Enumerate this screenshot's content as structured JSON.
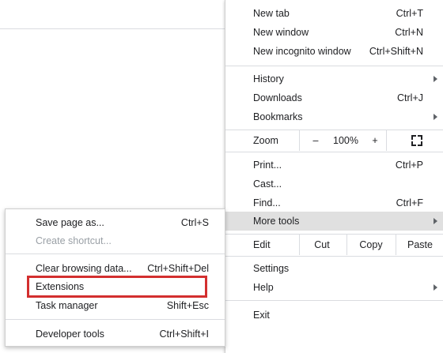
{
  "main_menu": {
    "new_tab": {
      "label": "New tab",
      "shortcut": "Ctrl+T"
    },
    "new_window": {
      "label": "New window",
      "shortcut": "Ctrl+N"
    },
    "new_incognito": {
      "label": "New incognito window",
      "shortcut": "Ctrl+Shift+N"
    },
    "history": {
      "label": "History"
    },
    "downloads": {
      "label": "Downloads",
      "shortcut": "Ctrl+J"
    },
    "bookmarks": {
      "label": "Bookmarks"
    },
    "zoom": {
      "label": "Zoom",
      "minus": "–",
      "value": "100%",
      "plus": "+"
    },
    "print": {
      "label": "Print...",
      "shortcut": "Ctrl+P"
    },
    "cast": {
      "label": "Cast..."
    },
    "find": {
      "label": "Find...",
      "shortcut": "Ctrl+F"
    },
    "more_tools": {
      "label": "More tools"
    },
    "edit": {
      "label": "Edit",
      "cut": "Cut",
      "copy": "Copy",
      "paste": "Paste"
    },
    "settings": {
      "label": "Settings"
    },
    "help": {
      "label": "Help"
    },
    "exit": {
      "label": "Exit"
    }
  },
  "more_tools_submenu": {
    "save_page": {
      "label": "Save page as...",
      "shortcut": "Ctrl+S"
    },
    "create_shortcut": {
      "label": "Create shortcut..."
    },
    "clear_browsing": {
      "label": "Clear browsing data...",
      "shortcut": "Ctrl+Shift+Del"
    },
    "extensions": {
      "label": "Extensions"
    },
    "task_manager": {
      "label": "Task manager",
      "shortcut": "Shift+Esc"
    },
    "developer_tools": {
      "label": "Developer tools",
      "shortcut": "Ctrl+Shift+I"
    }
  },
  "colors": {
    "highlight_box": "#d32f2f",
    "hover_row": "#e0e0e0"
  }
}
